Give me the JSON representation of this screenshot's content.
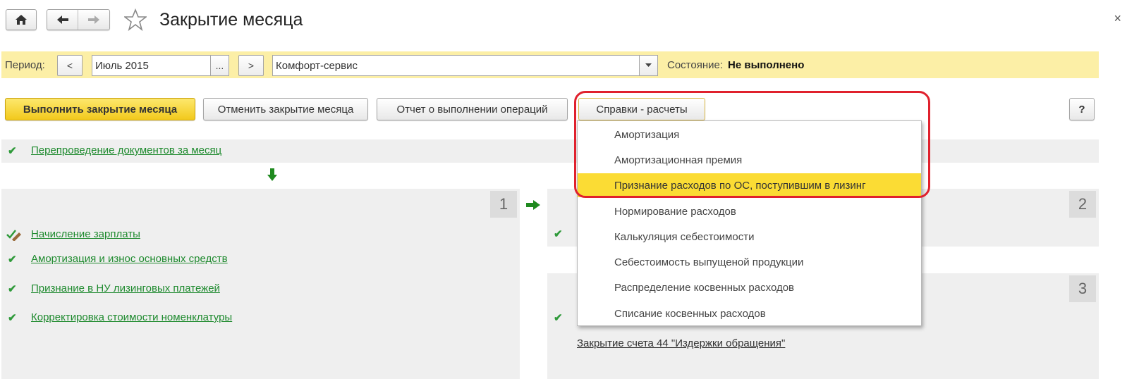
{
  "window": {
    "title": "Закрытие месяца",
    "close_glyph": "×"
  },
  "filters": {
    "period_label": "Период:",
    "prev_label": "<",
    "period_value": "Июль 2015",
    "ellipsis_label": "...",
    "next_label": ">",
    "org_value": "Комфорт-сервис",
    "state_label": "Состояние:",
    "state_value": "Не выполнено"
  },
  "toolbar": {
    "execute_label": "Выполнить закрытие месяца",
    "cancel_label": "Отменить закрытие месяца",
    "report_label": "Отчет о выполнении операций",
    "calc_label": "Справки - расчеты",
    "help_label": "?"
  },
  "dropdown": {
    "items": [
      "Амортизация",
      "Амортизационная премия",
      "Признание расходов по ОС, поступившим в лизинг",
      "Нормирование расходов",
      "Калькуляция себестоимости",
      "Себестоимость выпущеной продукции",
      "Распределение косвенных расходов",
      "Списание косвенных расходов"
    ],
    "selected_index": 2
  },
  "steps": {
    "top_link": "Перепроведение документов за месяц",
    "panel1_number": "1",
    "panel2_number": "2",
    "panel3_number": "3",
    "panel1_links": [
      "Начисление зарплаты",
      "Амортизация и износ основных средств",
      "Признание в НУ лизинговых платежей",
      "Корректировка стоимости номенклатуры"
    ],
    "panel3_link": "Закрытие счета 44 \"Издержки обращения\""
  },
  "colors": {
    "accent_yellow": "#fbdc34",
    "check_green": "#2f9a3a",
    "highlight_red": "#e0212d",
    "period_bar": "#fcefa6"
  }
}
